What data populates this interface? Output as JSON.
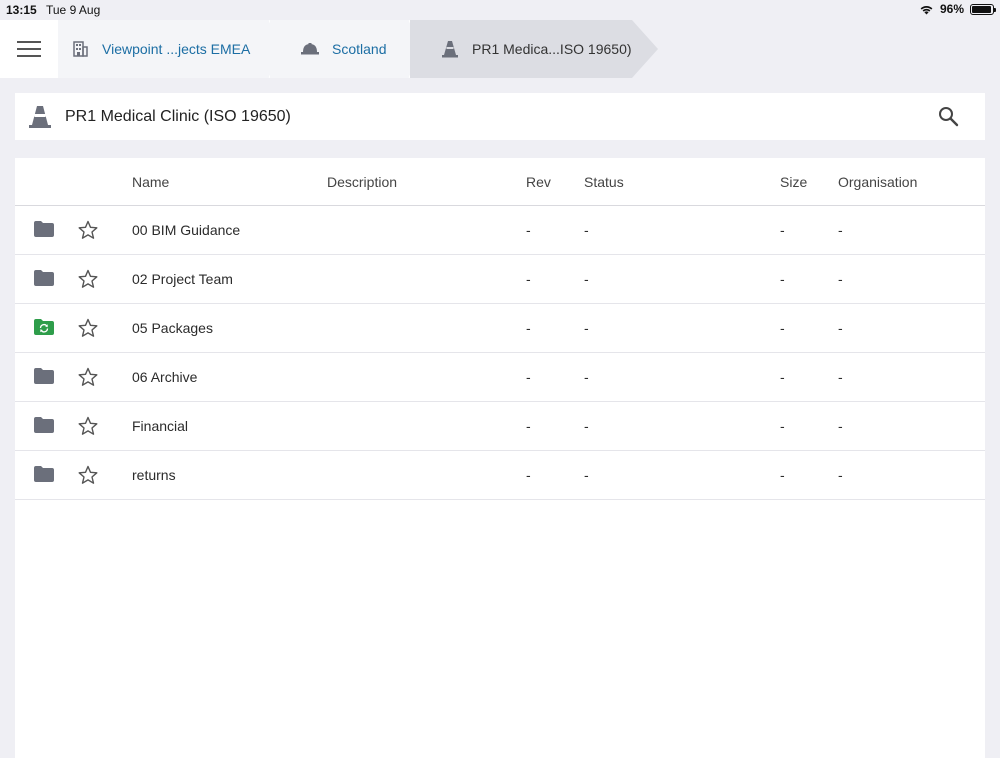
{
  "status": {
    "time": "13:15",
    "date": "Tue 9 Aug",
    "battery": "96%"
  },
  "breadcrumbs": [
    {
      "label": "Viewpoint ...jects EMEA",
      "icon": "building-icon"
    },
    {
      "label": "Scotland",
      "icon": "hard-hat-icon"
    },
    {
      "label": "PR1 Medica...ISO 19650)",
      "icon": "traffic-cone-icon"
    }
  ],
  "header": {
    "title": "PR1 Medical Clinic (ISO 19650)"
  },
  "table": {
    "columns": {
      "name": "Name",
      "description": "Description",
      "rev": "Rev",
      "status": "Status",
      "size": "Size",
      "organisation": "Organisation"
    },
    "rows": [
      {
        "name": "00 BIM Guidance",
        "rev": "-",
        "status": "-",
        "size": "-",
        "organisation": "-",
        "folder_type": "folder",
        "folder_color": "#6b6f7b"
      },
      {
        "name": "02 Project Team",
        "rev": "-",
        "status": "-",
        "size": "-",
        "organisation": "-",
        "folder_type": "folder",
        "folder_color": "#6b6f7b"
      },
      {
        "name": "05 Packages",
        "rev": "-",
        "status": "-",
        "size": "-",
        "organisation": "-",
        "folder_type": "sync-folder",
        "folder_color": "#2e9d4a"
      },
      {
        "name": "06 Archive",
        "rev": "-",
        "status": "-",
        "size": "-",
        "organisation": "-",
        "folder_type": "folder",
        "folder_color": "#6b6f7b"
      },
      {
        "name": "Financial",
        "rev": "-",
        "status": "-",
        "size": "-",
        "organisation": "-",
        "folder_type": "folder",
        "folder_color": "#6b6f7b"
      },
      {
        "name": "returns",
        "rev": "-",
        "status": "-",
        "size": "-",
        "organisation": "-",
        "folder_type": "folder",
        "folder_color": "#6b6f7b"
      }
    ]
  },
  "colors": {
    "link": "#1c6ea4",
    "icon": "#6b6f7b",
    "accent_green": "#2e9d4a"
  }
}
